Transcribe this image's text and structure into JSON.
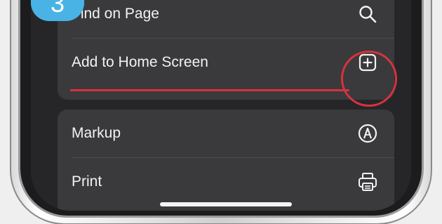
{
  "step_badge": "3",
  "menu": {
    "group1": [
      {
        "label": "Find on Page",
        "icon": "search-icon"
      },
      {
        "label": "Add to Home Screen",
        "icon": "add-square-icon"
      }
    ],
    "group2": [
      {
        "label": "Markup",
        "icon": "markup-pen-icon"
      },
      {
        "label": "Print",
        "icon": "printer-icon"
      }
    ]
  },
  "colors": {
    "highlight": "#d8323e",
    "badge": "#4ab3e6",
    "menu_bg": "#3a3a3c",
    "screen_bg": "#262628"
  }
}
